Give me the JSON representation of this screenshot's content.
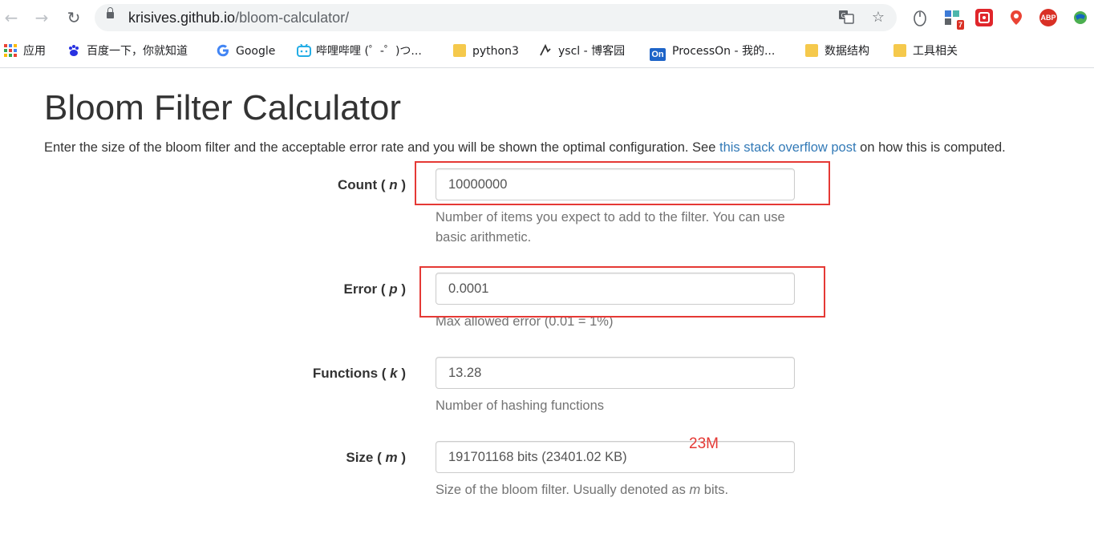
{
  "browser": {
    "url_host": "krisives.github.io",
    "url_path": "/bloom-calculator/",
    "extension_badge": "7",
    "extension_abp": "ABP",
    "bookmarks": [
      {
        "label": "应用",
        "icon": "apps-grid-icon"
      },
      {
        "label": "百度一下，你就知道",
        "icon": "baidu-paw-icon"
      },
      {
        "label": "Google",
        "icon": "google-g-icon"
      },
      {
        "label": "哔哩哔哩 (゜-゜)つ...",
        "icon": "bilibili-tv-icon"
      },
      {
        "label": "python3",
        "icon": "folder-icon"
      },
      {
        "label": "yscl - 博客园",
        "icon": "cnblogs-icon"
      },
      {
        "label": "ProcessOn - 我的...",
        "icon": "processon-icon"
      },
      {
        "label": "数据结构",
        "icon": "folder-icon"
      },
      {
        "label": "工具相关",
        "icon": "folder-icon"
      }
    ],
    "processon_icon_text": "On"
  },
  "page": {
    "title": "Bloom Filter Calculator",
    "desc_before": "Enter the size of the bloom filter and the acceptable error rate and you will be shown the optimal configuration. See ",
    "desc_link": "this stack overflow post",
    "desc_after": " on how this is computed."
  },
  "form": {
    "count": {
      "label": "Count ( ",
      "var": "n",
      "label_end": " )",
      "value": "10000000",
      "help": "Number of items you expect to add to the filter. You can use basic arithmetic."
    },
    "error": {
      "label": "Error ( ",
      "var": "p",
      "label_end": " )",
      "value": "0.0001",
      "help": "Max allowed error (0.01 = 1%)"
    },
    "functions": {
      "label": "Functions ( ",
      "var": "k",
      "label_end": " )",
      "value": "13.28",
      "help": "Number of hashing functions"
    },
    "size": {
      "label": "Size ( ",
      "var": "m",
      "label_end": " )",
      "value": "191701168 bits (23401.02 KB)",
      "help_before": "Size of the bloom filter. Usually denoted as ",
      "help_var": "m",
      "help_after": " bits."
    }
  },
  "annotation": {
    "note": "23M",
    "color": "#e53935"
  }
}
